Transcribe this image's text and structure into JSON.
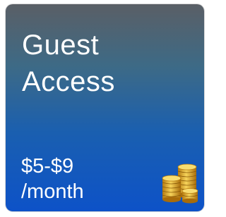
{
  "tile": {
    "title_line1": "Guest",
    "title_line2": "Access",
    "price_line1": "$5-$9",
    "price_line2": "/month",
    "icon": "coin-stacks-icon",
    "colors": {
      "gradient_top": "#5a5f66",
      "gradient_bottom": "#0d52c8",
      "text": "#ffffff",
      "coin_gold": "#e0a820"
    }
  }
}
